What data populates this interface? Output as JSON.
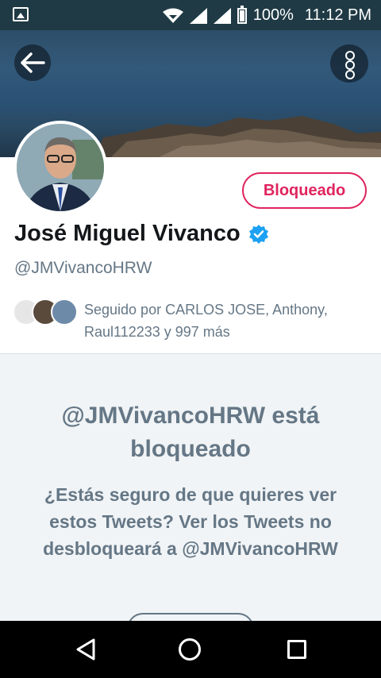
{
  "status": {
    "battery": "100%",
    "time": "11:12 PM"
  },
  "profile": {
    "name": "José Miguel Vivanco",
    "handle": "@JMVivancoHRW",
    "followed_by": "Seguido por CARLOS JOSE, Anthony, Raul112233 y 997 más",
    "blocked_button": "Bloqueado"
  },
  "blocked": {
    "title": "@JMVivancoHRW está bloqueado",
    "message": "¿Estás seguro de que quieres ver estos Tweets? Ver los Tweets no desbloqueará a @JMVivancoHRW"
  },
  "colors": {
    "accent": "#e0245e",
    "verified": "#1da1f2",
    "muted": "#657786"
  }
}
